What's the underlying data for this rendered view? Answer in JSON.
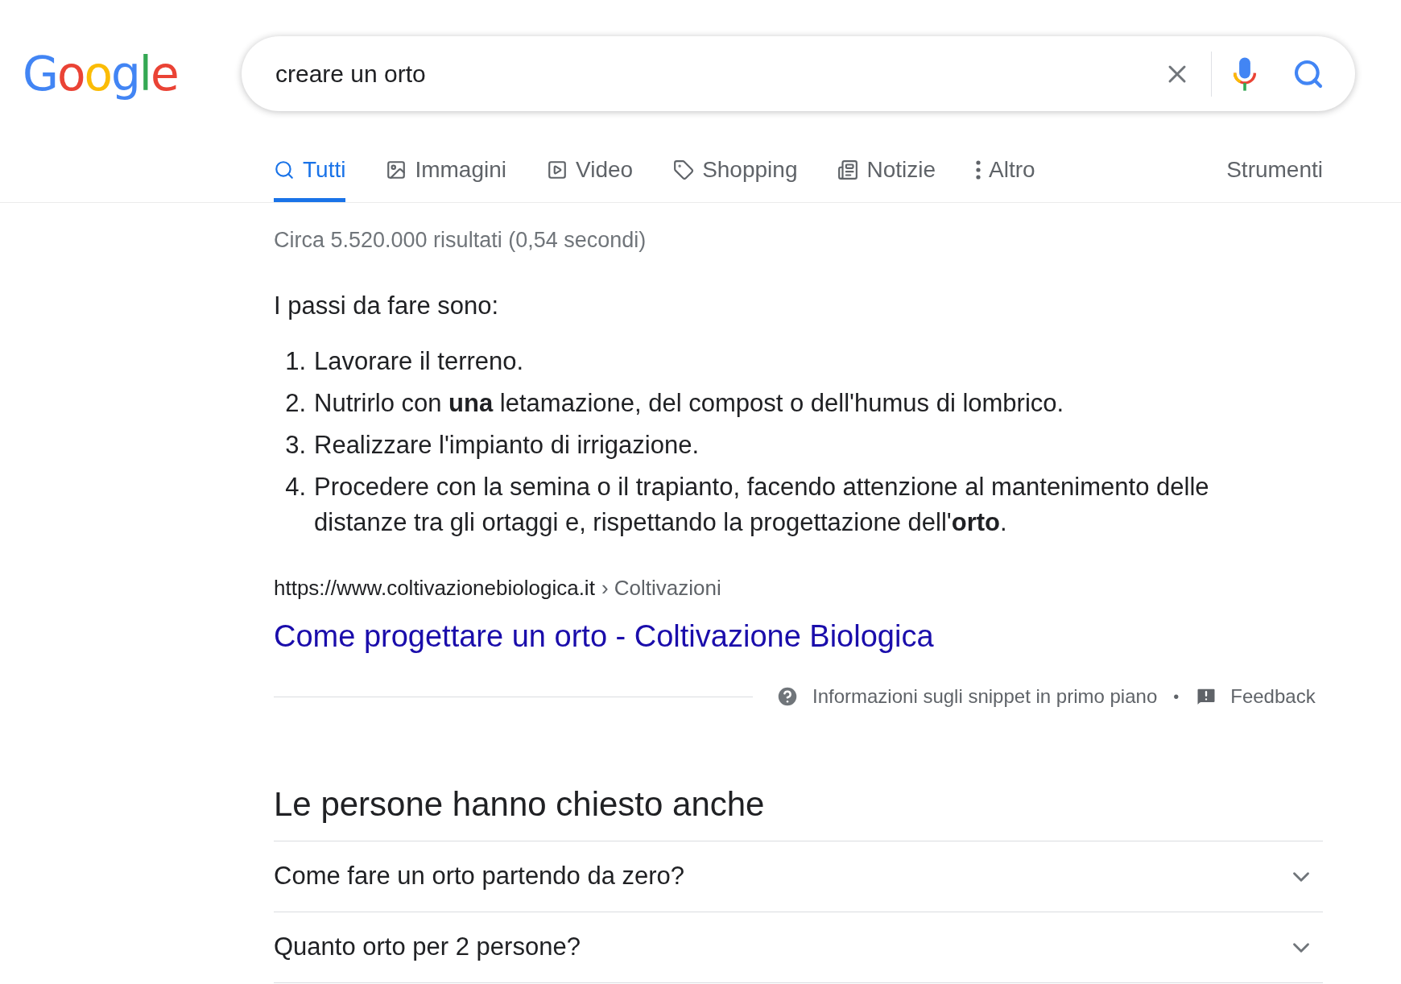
{
  "logo": "Google",
  "search": {
    "query": "creare un orto"
  },
  "tabs": [
    {
      "label": "Tutti",
      "kind": "search",
      "selected": true
    },
    {
      "label": "Immagini",
      "kind": "image",
      "selected": false
    },
    {
      "label": "Video",
      "kind": "video",
      "selected": false
    },
    {
      "label": "Shopping",
      "kind": "tag",
      "selected": false
    },
    {
      "label": "Notizie",
      "kind": "news",
      "selected": false
    },
    {
      "label": "Altro",
      "kind": "more",
      "selected": false
    }
  ],
  "tools": "Strumenti",
  "stats": "Circa 5.520.000 risultati (0,54 secondi)",
  "snippet": {
    "intro": "I passi da fare sono:",
    "steps": [
      {
        "number": "1.",
        "text": "Lavorare il terreno."
      },
      {
        "number": "2.",
        "text": "Nutrirlo con **una** letamazione, del compost o dell'humus di lombrico."
      },
      {
        "number": "3.",
        "text": "Realizzare l'impianto di irrigazione."
      },
      {
        "number": "4.",
        "text": "Procedere con la semina o il trapianto, facendo attenzione al mantenimento delle distanze tra gli ortaggi e, rispettando la progettazione dell'**orto**."
      }
    ],
    "url": "https://www.coltivazionebiologica.it",
    "breadcrumb": "› Coltivazioni",
    "title": "Come progettare un orto - Coltivazione Biologica",
    "about": "Informazioni sugli snippet in primo piano",
    "separator": "•",
    "feedback": "Feedback"
  },
  "people_also_ask": {
    "title": "Le persone hanno chiesto anche",
    "questions": [
      {
        "text": "Come fare un orto partendo da zero?",
        "expanded": false
      },
      {
        "text": "Quanto orto per 2 persone?",
        "expanded": false
      }
    ]
  }
}
